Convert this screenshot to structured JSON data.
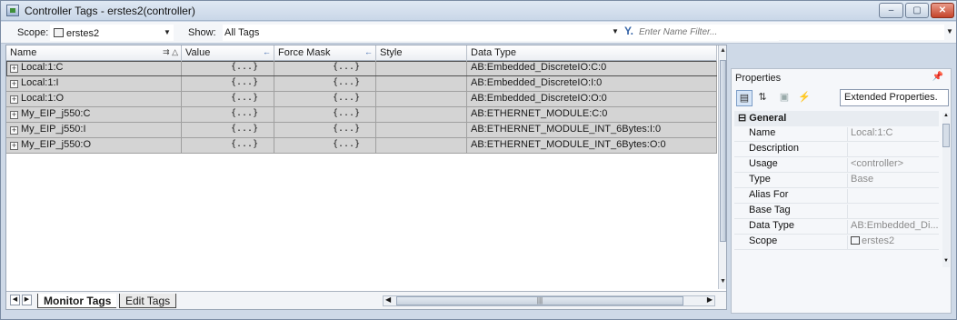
{
  "window": {
    "title": "Controller Tags - erstes2(controller)",
    "buttons": {
      "minimize": "–",
      "maximize": "▢",
      "close": "✕"
    }
  },
  "toolbar": {
    "scope_label": "Scope:",
    "scope_value": "erstes2",
    "show_label": "Show:",
    "show_value": "All Tags",
    "filter_placeholder": "Enter Name Filter..."
  },
  "grid": {
    "columns": {
      "name": "Name",
      "value": "Value",
      "force_mask": "Force Mask",
      "style": "Style",
      "data_type": "Data Type"
    },
    "rows": [
      {
        "name": "Local:1:C",
        "value": "{...}",
        "force_mask": "{...}",
        "style": "",
        "data_type": "AB:Embedded_DiscreteIO:C:0"
      },
      {
        "name": "Local:1:I",
        "value": "{...}",
        "force_mask": "{...}",
        "style": "",
        "data_type": "AB:Embedded_DiscreteIO:I:0"
      },
      {
        "name": "Local:1:O",
        "value": "{...}",
        "force_mask": "{...}",
        "style": "",
        "data_type": "AB:Embedded_DiscreteIO:O:0"
      },
      {
        "name": "My_EIP_j550:C",
        "value": "{...}",
        "force_mask": "{...}",
        "style": "",
        "data_type": "AB:ETHERNET_MODULE:C:0"
      },
      {
        "name": "My_EIP_j550:I",
        "value": "{...}",
        "force_mask": "{...}",
        "style": "",
        "data_type": "AB:ETHERNET_MODULE_INT_6Bytes:I:0"
      },
      {
        "name": "My_EIP_j550:O",
        "value": "{...}",
        "force_mask": "{...}",
        "style": "",
        "data_type": "AB:ETHERNET_MODULE_INT_6Bytes:O:0"
      }
    ]
  },
  "tabs": {
    "monitor": "Monitor Tags",
    "edit": "Edit Tags"
  },
  "properties": {
    "title": "Properties",
    "view_combo": "Extended Properties.",
    "category": "General",
    "items": [
      {
        "name": "Name",
        "value": "Local:1:C"
      },
      {
        "name": "Description",
        "value": ""
      },
      {
        "name": "Usage",
        "value": "<controller>"
      },
      {
        "name": "Type",
        "value": "Base"
      },
      {
        "name": "Alias For",
        "value": ""
      },
      {
        "name": "Base Tag",
        "value": ""
      },
      {
        "name": "Data Type",
        "value": "AB:Embedded_Di..."
      },
      {
        "name": "Scope",
        "value": "erstes2"
      }
    ]
  }
}
